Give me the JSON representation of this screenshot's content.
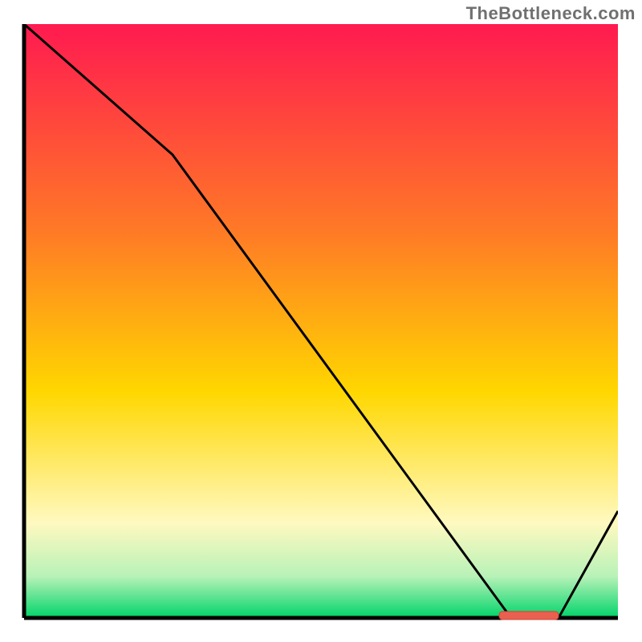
{
  "watermark": "TheBottleneck.com",
  "marker_label": "",
  "colors": {
    "grad_top": "#ff1a50",
    "grad_upper_mid": "#ff7a26",
    "grad_mid": "#ffd700",
    "grad_lower_mid": "#fff9c0",
    "grad_near_bottom": "#b8f2b8",
    "grad_bottom": "#00d46a",
    "axis": "#000000",
    "line": "#000000",
    "marker_fill": "#e86050",
    "marker_stroke": "#d84030"
  },
  "chart_data": {
    "type": "line",
    "title": "",
    "xlabel": "",
    "ylabel": "",
    "xlim": [
      0,
      100
    ],
    "ylim": [
      0,
      100
    ],
    "x": [
      0,
      25,
      82,
      90,
      100
    ],
    "values": [
      100,
      78,
      0,
      0,
      18
    ],
    "marker": {
      "x_start": 80,
      "x_end": 90,
      "y": 0
    }
  }
}
